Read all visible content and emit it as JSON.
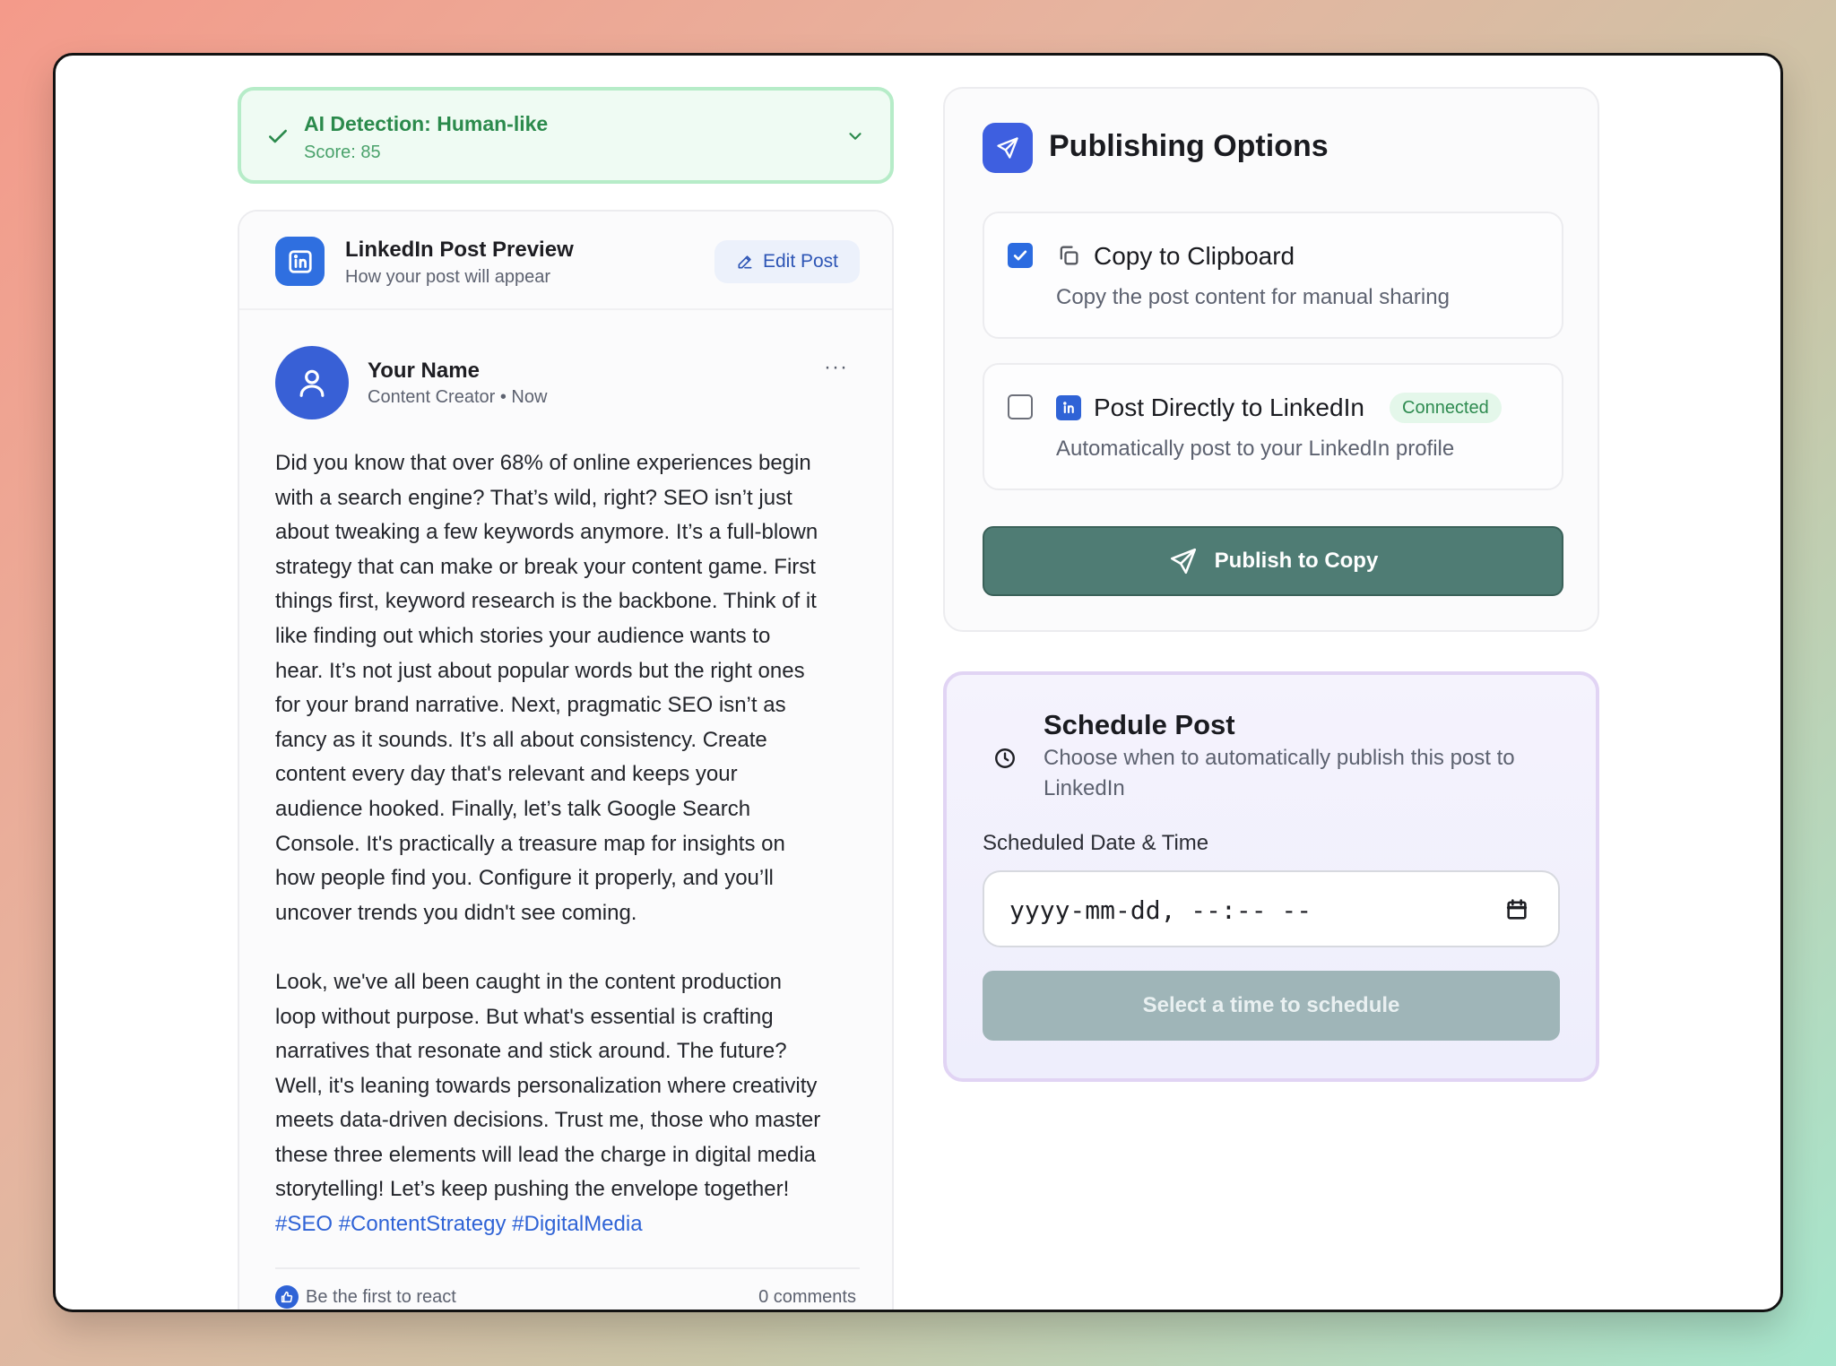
{
  "ai_detection": {
    "title": "AI Detection: Human-like",
    "score": "Score: 85"
  },
  "post_preview": {
    "title": "LinkedIn Post Preview",
    "subtitle": "How your post will appear",
    "edit_label": "Edit Post",
    "author_name": "Your Name",
    "author_meta": "Content Creator • Now",
    "more_label": "···",
    "body": "Did you know that over 68% of online experiences begin\nwith a search engine? That’s wild, right? SEO isn’t just\nabout tweaking a few keywords anymore. It’s a full-blown\nstrategy that can make or break your content game. First\nthings first, keyword research is the backbone. Think of it\nlike finding out which stories your audience wants to\nhear. It’s not just about popular words but the right ones\nfor your brand narrative. Next, pragmatic SEO isn’t as\nfancy as it sounds. It’s all about consistency. Create\ncontent every day that's relevant and keeps your\naudience hooked. Finally, let’s talk Google Search\nConsole. It's practically a treasure map for insights on\nhow people find you. Configure it properly, and you’ll\nuncover trends you didn't see coming.\n\nLook, we've all been caught in the content production\nloop without purpose. But what's essential is crafting\nnarratives that resonate and stick around. The future?\nWell, it's leaning towards personalization where creativity\nmeets data-driven decisions. Trust me, those who master\nthese three elements will lead the charge in digital media\nstorytelling! Let’s keep pushing the envelope together!",
    "hashtags": "#SEO #ContentStrategy #DigitalMedia",
    "react_label": "Be the first to react",
    "comments_label": "0 comments"
  },
  "publishing": {
    "title": "Publishing Options",
    "options": [
      {
        "title": "Copy to Clipboard",
        "description": "Copy the post content for manual sharing",
        "checked": true
      },
      {
        "title": "Post Directly to LinkedIn",
        "badge": "Connected",
        "description": "Automatically post to your LinkedIn profile",
        "checked": false
      }
    ],
    "publish_button": "Publish to Copy"
  },
  "schedule": {
    "title": "Schedule Post",
    "description": "Choose when to automatically publish this post to LinkedIn",
    "field_label": "Scheduled Date & Time",
    "date_placeholder": "yyyy-mm-dd, --:-- --",
    "button": "Select a time to schedule"
  },
  "colors": {
    "accent_blue": "#2f63d6",
    "success_green": "#2b8a4c",
    "publish_teal": "#4f7c74",
    "disabled_button": "#9fb5b8"
  },
  "icons": [
    "check-icon",
    "chevron-down-icon",
    "linkedin-icon",
    "pencil-icon",
    "user-icon",
    "more-icon",
    "send-icon",
    "copy-icon",
    "clock-icon",
    "calendar-icon",
    "thumbs-up-icon"
  ]
}
